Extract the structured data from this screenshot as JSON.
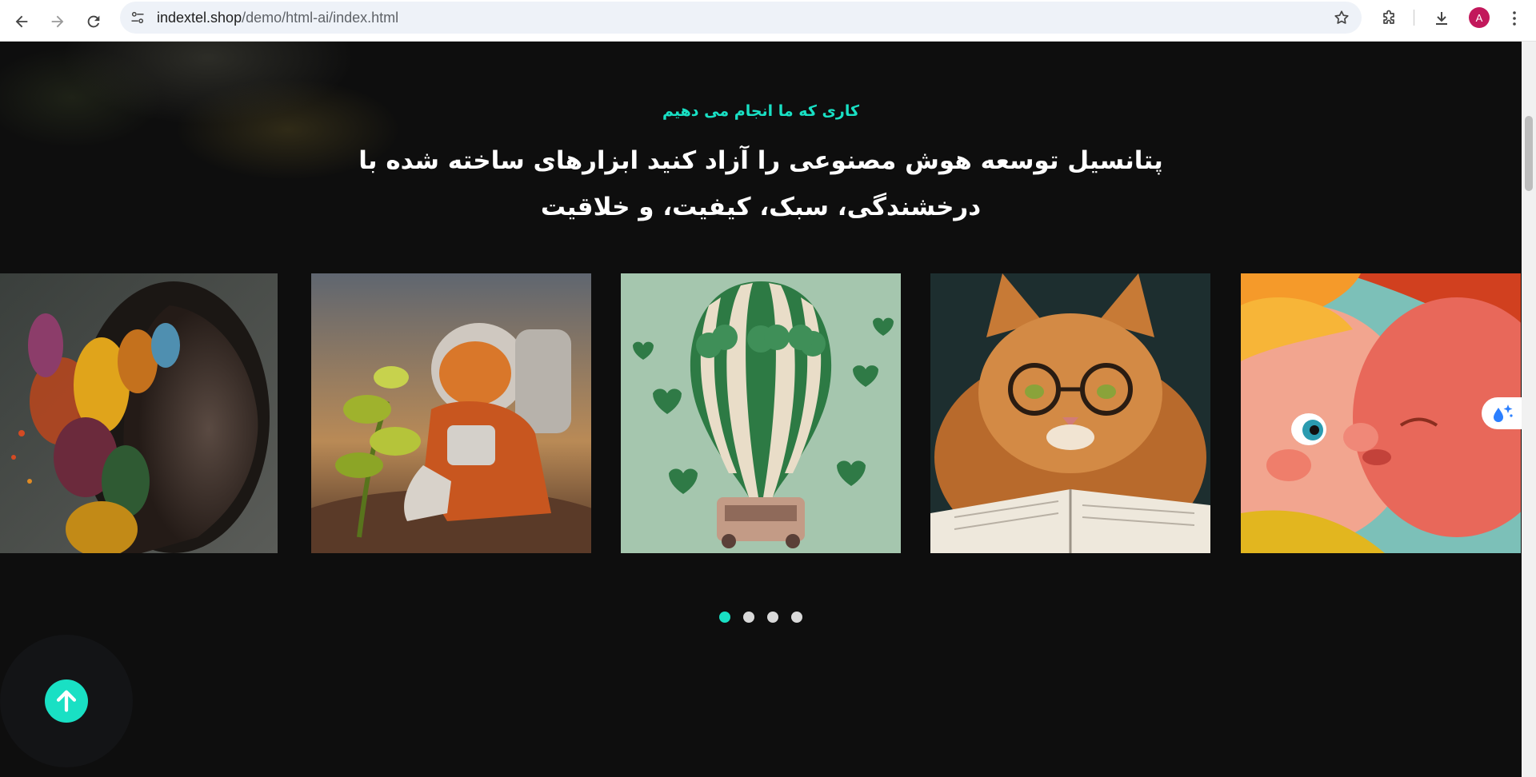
{
  "browser": {
    "url_host": "indextel.shop",
    "url_path": "/demo/html-ai/index.html",
    "profile_initial": "A"
  },
  "section": {
    "eyebrow": "کاری که ما انجام می دهیم",
    "headline": "پتانسیل توسعه هوش مصنوعی را آزاد کنید ابزارهای ساخته شده با درخشندگی، سبک، کیفیت، و خلاقیت"
  },
  "slider": {
    "slides": [
      "woman-portrait-with-leaves",
      "astronaut-planting",
      "clover-hot-air-balloon",
      "cat-with-glasses-reading",
      "cartoon-kiss"
    ],
    "dots": 4,
    "active_dot": 0
  },
  "colors": {
    "accent": "#19e0c4",
    "background": "#0e0e0e",
    "avatar": "#c2185b"
  },
  "icons": {
    "back": "arrow-left-icon",
    "forward": "arrow-right-icon",
    "reload": "reload-icon",
    "site_info": "tune-icon",
    "bookmark": "star-icon",
    "extensions": "puzzle-icon",
    "downloads": "download-icon",
    "menu": "kebab-menu-icon",
    "float": "sparkle-drop-icon",
    "back_to_top": "arrow-up-icon"
  }
}
